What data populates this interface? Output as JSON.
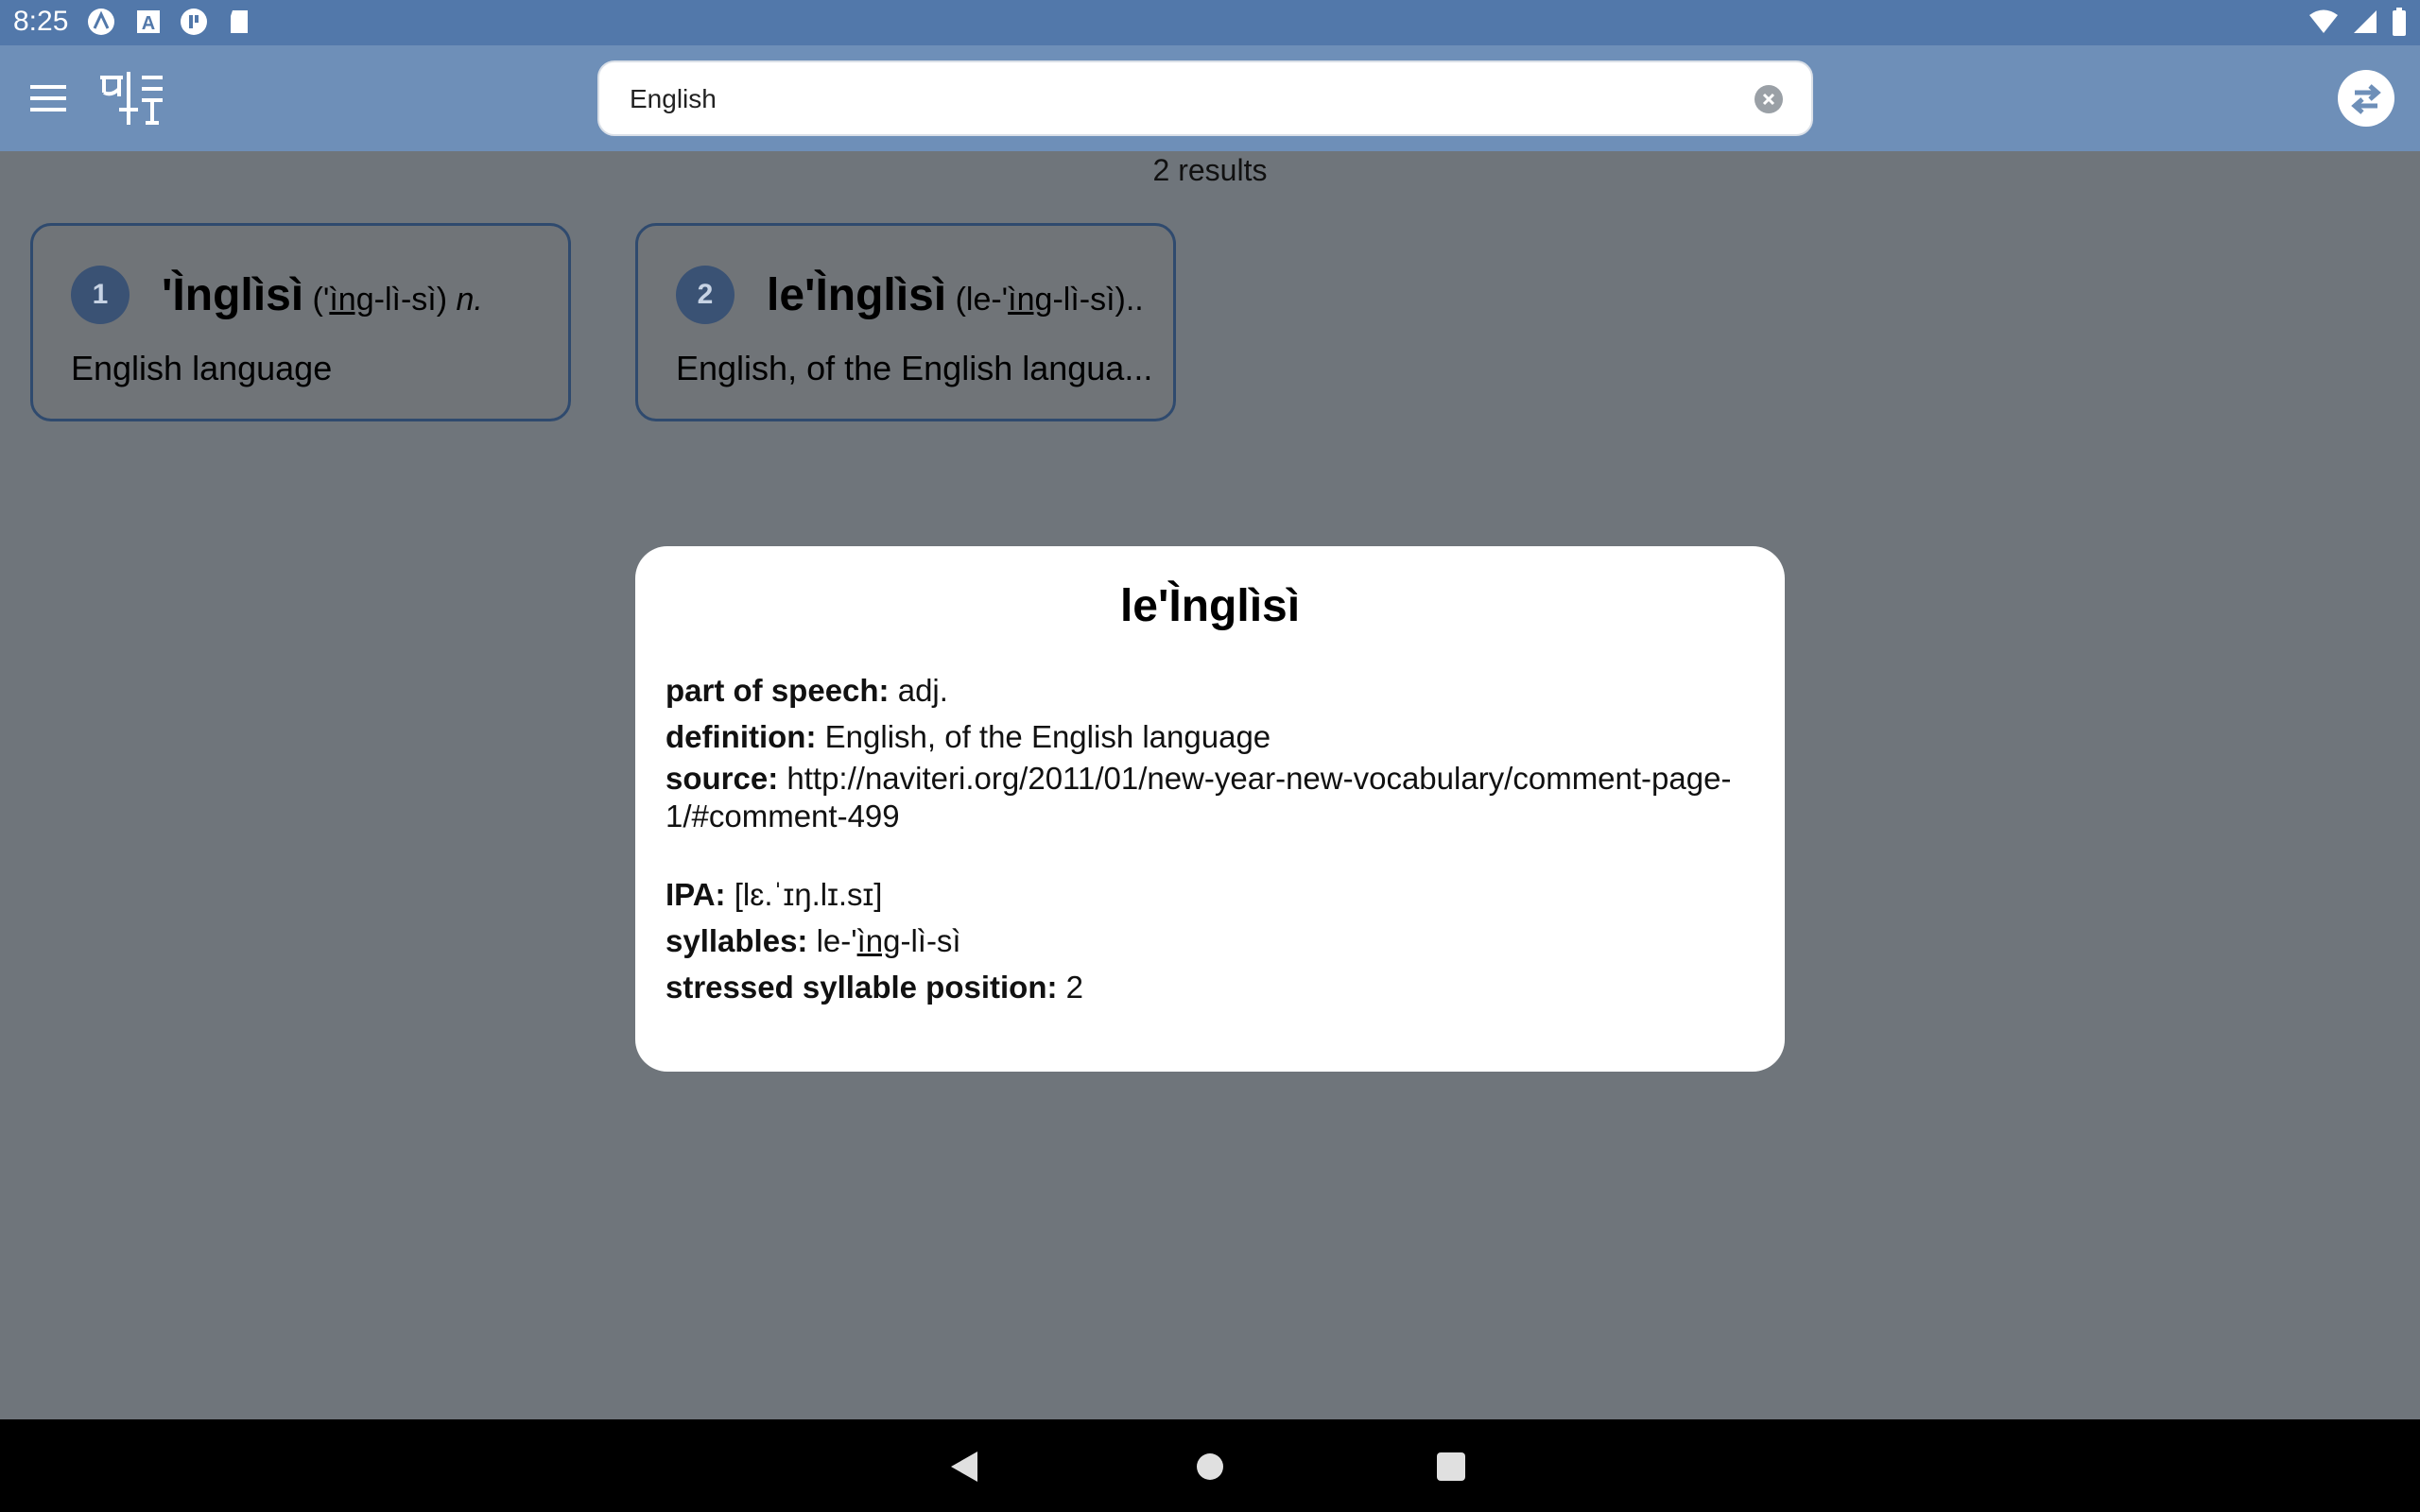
{
  "status_bar": {
    "time": "8:25",
    "icons": [
      "android-auto-icon",
      "a-box-icon",
      "circle-p-icon",
      "sd-card-icon",
      "wifi-icon",
      "signal-icon",
      "battery-icon"
    ]
  },
  "app_bar": {
    "menu_icon": "hamburger-menu-icon",
    "logo_icon": "dictionary-logo-icon",
    "search": {
      "value": "English",
      "placeholder": ""
    },
    "swap_icon": "swap-direction-icon"
  },
  "results": {
    "count_text": "2 results",
    "items": [
      {
        "number": "1",
        "word": "'Ìnglìsì",
        "pron_open": " ('",
        "pron_stress": "ìng",
        "pron_rest": "-lì-sì) ",
        "pos": "n.",
        "definition": "English language"
      },
      {
        "number": "2",
        "word": "le'Ìnglìsì",
        "pron_open": " (le-'",
        "pron_stress": "ìng",
        "pron_rest": "-lì-sì)...",
        "pos": "",
        "definition": "English, of the English langua..."
      }
    ]
  },
  "detail": {
    "title": "le'Ìnglìsì",
    "pos_label": "part of speech:",
    "pos_value": "adj.",
    "def_label": "definition:",
    "def_value": "English, of the English language",
    "source_label": "source:",
    "source_value": "http://naviteri.org/2011/01/new-year-new-vocabulary/comment-page-1/#comment-499",
    "ipa_label": "IPA:",
    "ipa_value": "[lɛ.ˈɪŋ.lɪ.sɪ]",
    "syll_label": "syllables:",
    "syll_before": "le-'",
    "syll_stress": "ìng",
    "syll_after": "-lì-sì",
    "stress_label": "stressed syllable position:",
    "stress_value": "2"
  },
  "nav_bar": {
    "icons": [
      "back-icon",
      "home-icon",
      "recents-icon"
    ]
  },
  "colors": {
    "status_bar": "#5278aa",
    "app_bar": "#6e8fb8",
    "scrim_background": "#6f757b",
    "card_border": "#2f4a6e",
    "badge": "#3a5274"
  }
}
